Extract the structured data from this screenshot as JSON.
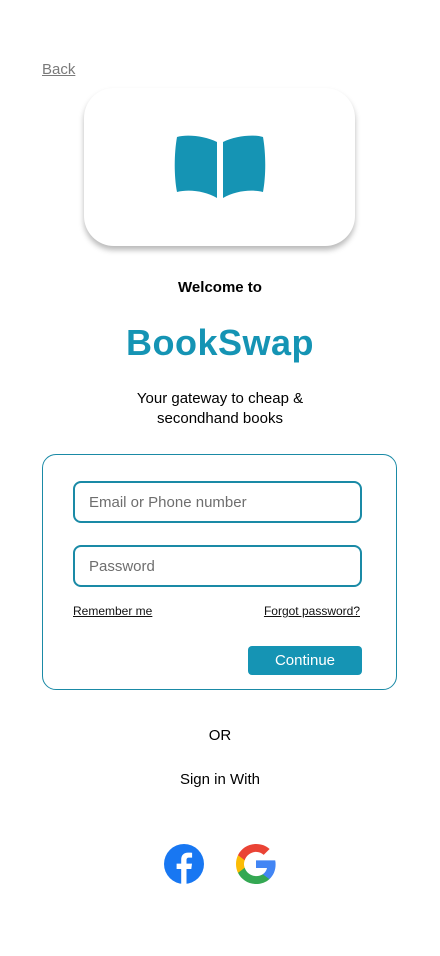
{
  "nav": {
    "back_label": "Back"
  },
  "hero": {
    "welcome": "Welcome to",
    "brand": "BookSwap",
    "tagline": "Your gateway to cheap & secondhand books",
    "logo_icon": "open-book-icon"
  },
  "form": {
    "email_placeholder": "Email or Phone number",
    "password_placeholder": "Password",
    "remember_label": "Remember me",
    "forgot_label": "Forgot password?",
    "continue_label": "Continue"
  },
  "alt": {
    "or_label": "OR",
    "sign_in_with": "Sign in With",
    "providers": [
      {
        "name": "facebook",
        "icon": "facebook-icon"
      },
      {
        "name": "google",
        "icon": "google-icon"
      }
    ]
  },
  "colors": {
    "accent": "#1594b4",
    "border": "#1a8aa6"
  }
}
